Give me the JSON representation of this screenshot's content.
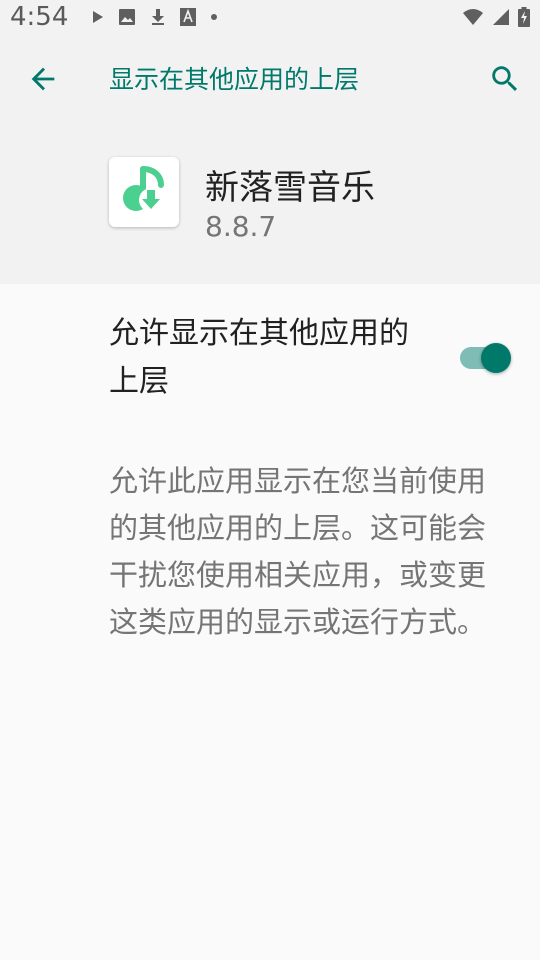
{
  "status_bar": {
    "time": "4:54",
    "left_icons": [
      "play-icon",
      "image-icon",
      "download-icon",
      "font-icon",
      "dot-icon"
    ],
    "right_icons": [
      "wifi-icon",
      "signal-icon",
      "battery-charging-icon"
    ]
  },
  "header": {
    "title": "显示在其他应用的上层"
  },
  "app": {
    "name": "新落雪音乐",
    "version": "8.8.7",
    "icon": "music-download-icon"
  },
  "preference": {
    "title": "允许显示在其他应用的上层",
    "enabled": true,
    "summary": "允许此应用显示在您当前使用的其他应用的上层。这可能会干扰您使用相关应用，或变更这类应用的显示或运行方式。"
  },
  "colors": {
    "accent": "#00796b",
    "toggle_track": "#7fbcb5",
    "header_bg": "#f2f2f2",
    "page_bg": "#fafafa",
    "app_icon_green": "#4cd08f"
  }
}
